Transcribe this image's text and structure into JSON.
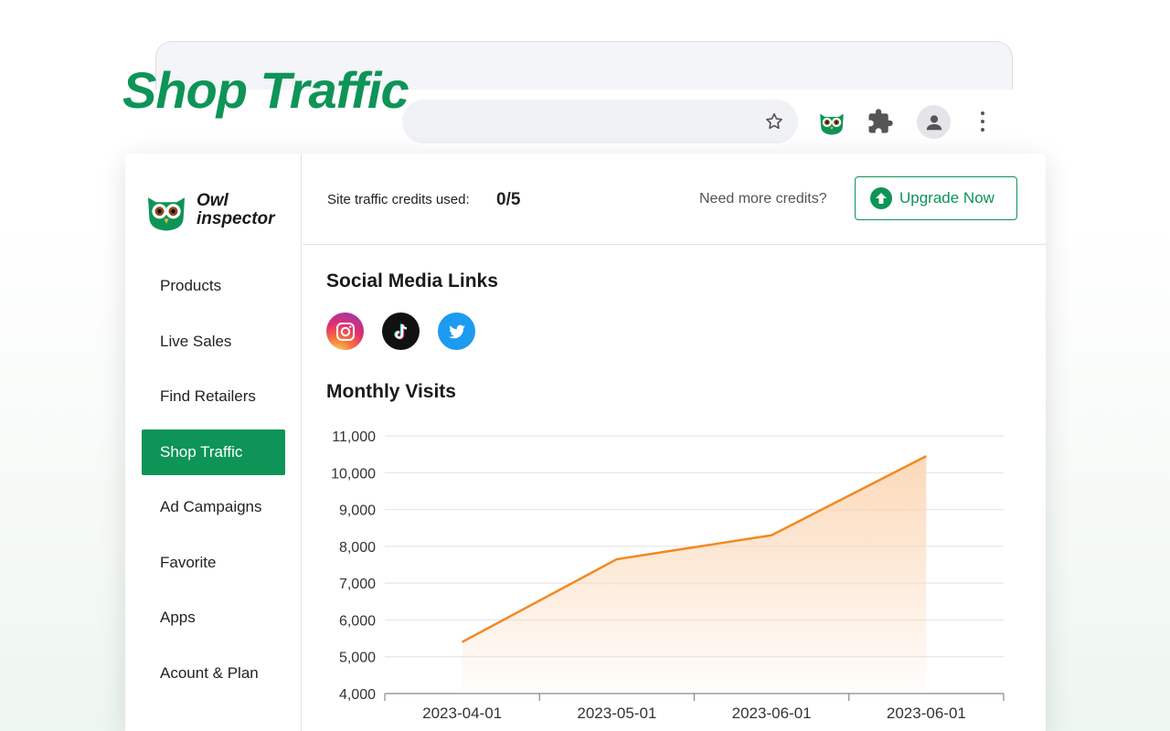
{
  "hero": {
    "title": "Shop Traffic"
  },
  "browser": {
    "buttons": [
      "star-icon",
      "owl-extension-icon",
      "puzzle-icon",
      "profile-icon",
      "more-vert-icon"
    ]
  },
  "brand": {
    "line1": "Owl",
    "line2": "inspector",
    "color": "#0e9457"
  },
  "sidebar": {
    "items": [
      {
        "label": "Products",
        "active": false
      },
      {
        "label": "Live Sales",
        "active": false
      },
      {
        "label": "Find Retailers",
        "active": false
      },
      {
        "label": "Shop Traffic",
        "active": true
      },
      {
        "label": "Ad Campaigns",
        "active": false
      },
      {
        "label": "Favorite",
        "active": false
      },
      {
        "label": "Apps",
        "active": false
      },
      {
        "label": "Acount & Plan",
        "active": false
      }
    ]
  },
  "topbar": {
    "credits_label": "Site traffic credits used:",
    "credits_value": "0/5",
    "need_more": "Need more credits?",
    "upgrade_label": "Upgrade Now"
  },
  "social": {
    "title": "Social Media Links",
    "links": [
      {
        "name": "instagram",
        "icon": "instagram-icon"
      },
      {
        "name": "tiktok",
        "icon": "tiktok-icon"
      },
      {
        "name": "twitter",
        "icon": "twitter-icon"
      }
    ]
  },
  "chart_section": {
    "title": "Monthly Visits"
  },
  "chart_data": {
    "type": "area",
    "title": "Monthly Visits",
    "categories": [
      "2023-04-01",
      "2023-05-01",
      "2023-06-01",
      "2023-06-01"
    ],
    "series": [
      {
        "values": [
          5400,
          7650,
          8300,
          10450
        ]
      }
    ],
    "y_ticks": [
      4000,
      5000,
      6000,
      7000,
      8000,
      9000,
      10000,
      11000
    ],
    "y_tick_labels": [
      "4,000",
      "5,000",
      "6,000",
      "7,000",
      "8,000",
      "9,000",
      "10,000",
      "11,000"
    ],
    "ylim": [
      4000,
      11000
    ],
    "grid": true,
    "line_color": "#f08a24",
    "fill_color": "#fbd7b6"
  }
}
